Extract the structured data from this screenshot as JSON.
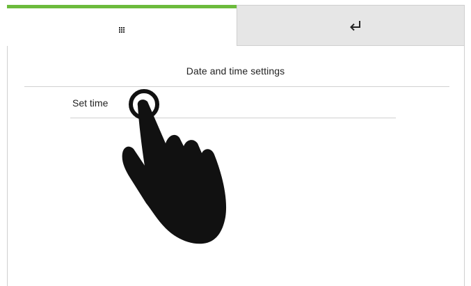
{
  "tabs": {
    "home_icon": "apps-grid-icon",
    "back_icon": "return-arrow-icon",
    "active_color": "#6cbb3c"
  },
  "screen": {
    "title": "Date and time settings"
  },
  "menu": {
    "items": [
      {
        "label": "Set time"
      }
    ]
  },
  "overlay": {
    "icon": "tap-gesture-hand-icon"
  }
}
